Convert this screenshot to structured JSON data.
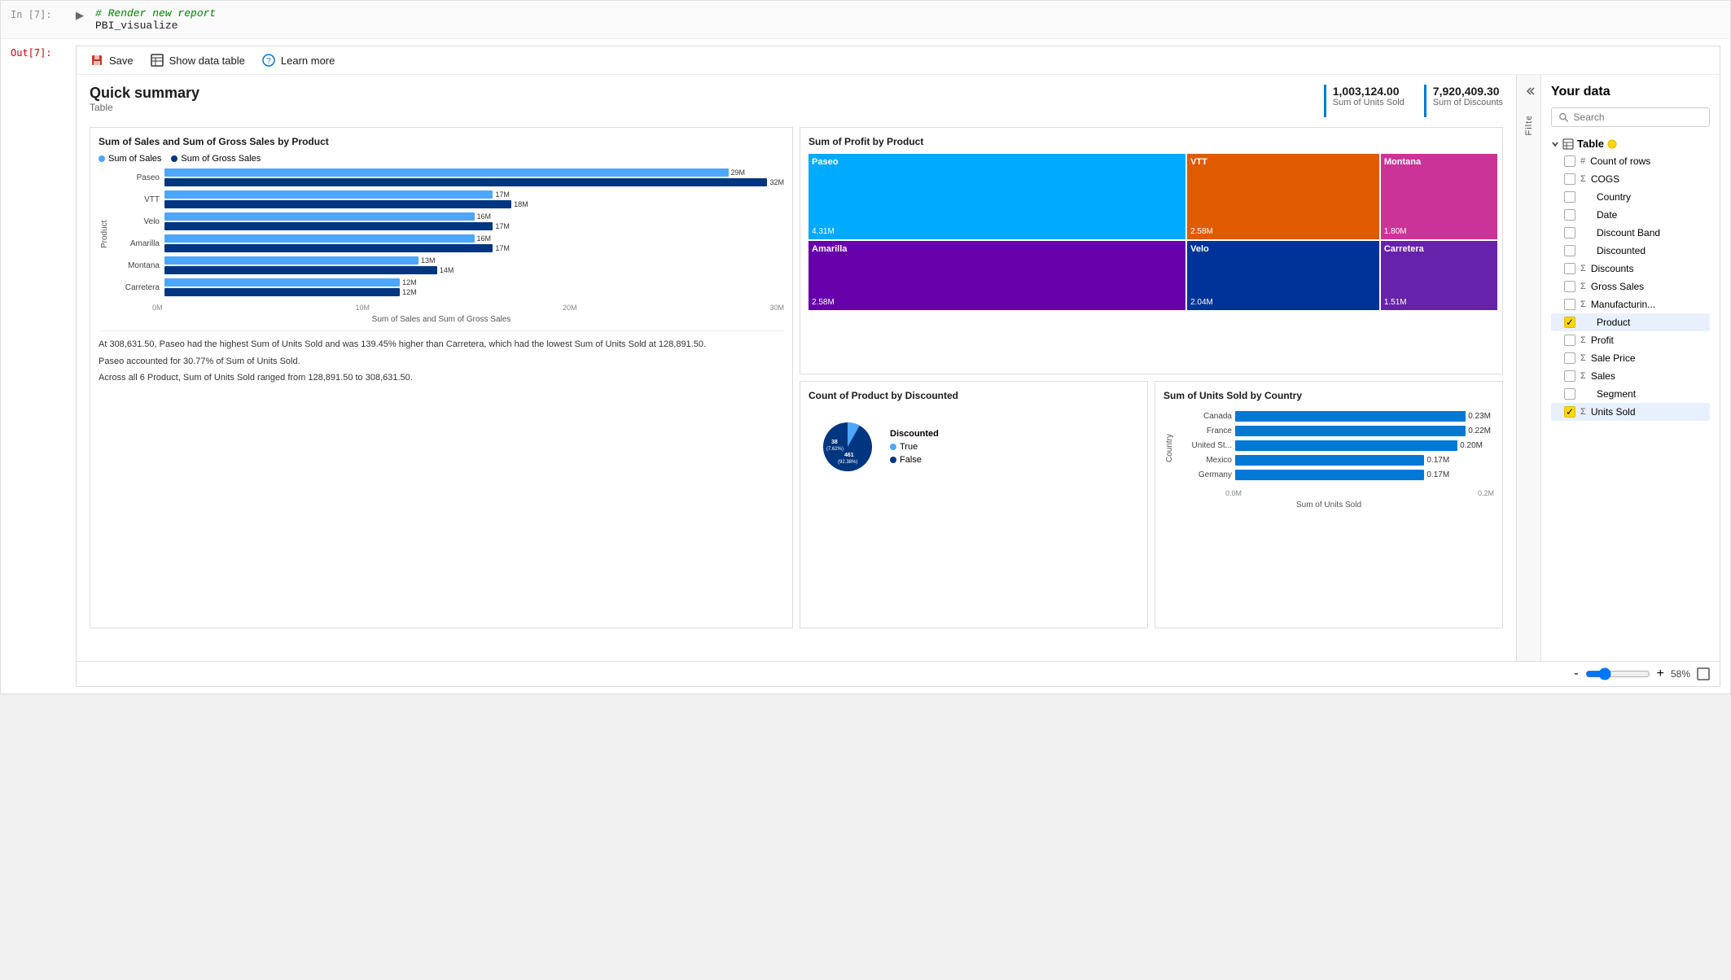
{
  "notebook": {
    "in_label": "In [7]:",
    "out_label": "Out[7]:",
    "comment": "# Render new report",
    "code": "PBI_visualize"
  },
  "toolbar": {
    "save_label": "Save",
    "show_data_table_label": "Show data table",
    "learn_more_label": "Learn more"
  },
  "quick_summary": {
    "title": "Quick summary",
    "subtitle": "Table",
    "stat1_value": "1,003,124.00",
    "stat1_label": "Sum of Units Sold",
    "stat2_value": "7,920,409.30",
    "stat2_label": "Sum of Discounts"
  },
  "bar_chart": {
    "title": "Sum of Sales and Sum of Gross Sales by Product",
    "legend": [
      {
        "label": "Sum of Sales",
        "color": "#4da6ff"
      },
      {
        "label": "Sum of Gross Sales",
        "color": "#003580"
      }
    ],
    "y_axis": "Product",
    "x_axis_title": "Sum of Sales and Sum of Gross Sales",
    "axis_labels": [
      "0M",
      "10M",
      "20M",
      "30M"
    ],
    "rows": [
      {
        "product": "Paseo",
        "sales": 29,
        "gross": 32,
        "sales_label": "29M",
        "gross_label": "32M",
        "sales_pct": 91,
        "gross_pct": 100
      },
      {
        "product": "VTT",
        "sales": 17,
        "gross": 18,
        "sales_label": "17M",
        "gross_label": "18M",
        "sales_pct": 53,
        "gross_pct": 56
      },
      {
        "product": "Velo",
        "sales": 16,
        "gross": 17,
        "sales_label": "16M",
        "gross_label": "17M",
        "sales_pct": 50,
        "gross_pct": 53
      },
      {
        "product": "Amarilla",
        "sales": 16,
        "gross": 17,
        "sales_label": "16M",
        "gross_label": "17M",
        "sales_pct": 50,
        "gross_pct": 53
      },
      {
        "product": "Montana",
        "sales": 13,
        "gross": 14,
        "sales_label": "13M",
        "gross_label": "14M",
        "sales_pct": 41,
        "gross_pct": 44
      },
      {
        "product": "Carretera",
        "sales": 12,
        "gross": 12,
        "sales_label": "12M",
        "gross_label": "12M",
        "sales_pct": 38,
        "gross_pct": 38
      }
    ],
    "text_summary": [
      "At 308,631.50, Paseo had the highest Sum of Units Sold and was 139.45% higher than Carretera, which had the lowest Sum of Units Sold at 128,891.50.",
      "Paseo accounted for 30.77% of Sum of Units Sold.",
      "Across all 6 Product, Sum of Units Sold ranged from 128,891.50 to 308,631.50."
    ]
  },
  "treemap": {
    "title": "Sum of Profit by Product",
    "cells": [
      {
        "label": "Paseo",
        "value": "4.31M",
        "color": "#00aaff",
        "col": 1,
        "row": 1
      },
      {
        "label": "VTT",
        "value": "2.58M",
        "color": "#e05a00",
        "col": 2,
        "row": 1
      },
      {
        "label": "Montana",
        "value": "1.80M",
        "color": "#cc3399",
        "col": 3,
        "row": 1
      },
      {
        "label": "Amarilla",
        "value": "2.58M",
        "color": "#6600aa",
        "col": 1,
        "row": 2
      },
      {
        "label": "Velo",
        "value": "2.04M",
        "color": "#003399",
        "col": 2,
        "row": 2
      },
      {
        "label": "Carretera",
        "value": "1.51M",
        "color": "#6622aa",
        "col": 3,
        "row": 2
      }
    ]
  },
  "pie_chart": {
    "title": "Count of Product by Discounted",
    "legend_title": "Discounted",
    "segments": [
      {
        "label": "True",
        "value": "38 (7.62%)",
        "color": "#4da6ff",
        "percent": 7.62
      },
      {
        "label": "False",
        "value": "461 (92.38%)",
        "color": "#003580",
        "percent": 92.38
      }
    ],
    "labels": [
      {
        "text": "38",
        "sub": "(7.62%)"
      },
      {
        "text": "461",
        "sub": "(92.38%)"
      }
    ]
  },
  "hbar_chart": {
    "title": "Sum of Units Sold by Country",
    "y_axis": "Country",
    "x_axis_title": "Sum of Units Sold",
    "axis_labels": [
      "0.0M",
      "0.2M"
    ],
    "rows": [
      {
        "country": "Canada",
        "value": "0.23M",
        "pct": 100
      },
      {
        "country": "France",
        "value": "0.22M",
        "pct": 96
      },
      {
        "country": "United St...",
        "value": "0.20M",
        "pct": 87
      },
      {
        "country": "Mexico",
        "value": "0.17M",
        "pct": 74
      },
      {
        "country": "Germany",
        "value": "0.17M",
        "pct": 74
      }
    ]
  },
  "your_data": {
    "title": "Your data",
    "search_placeholder": "Search",
    "table_name": "Table",
    "fields": [
      {
        "name": "Count of rows",
        "type": "count",
        "checked": false,
        "sigma": false
      },
      {
        "name": "COGS",
        "type": "sigma",
        "checked": false,
        "sigma": true
      },
      {
        "name": "Country",
        "type": "text",
        "checked": false,
        "sigma": false
      },
      {
        "name": "Date",
        "type": "text",
        "checked": false,
        "sigma": false
      },
      {
        "name": "Discount Band",
        "type": "text",
        "checked": false,
        "sigma": false
      },
      {
        "name": "Discounted",
        "type": "text",
        "checked": false,
        "sigma": false
      },
      {
        "name": "Discounts",
        "type": "sigma",
        "checked": false,
        "sigma": true
      },
      {
        "name": "Gross Sales",
        "type": "sigma",
        "checked": false,
        "sigma": true
      },
      {
        "name": "Manufacturin...",
        "type": "sigma",
        "checked": false,
        "sigma": true
      },
      {
        "name": "Product",
        "type": "text",
        "checked": true,
        "sigma": false
      },
      {
        "name": "Profit",
        "type": "sigma",
        "checked": false,
        "sigma": true
      },
      {
        "name": "Sale Price",
        "type": "sigma",
        "checked": false,
        "sigma": true
      },
      {
        "name": "Sales",
        "type": "sigma",
        "checked": false,
        "sigma": true
      },
      {
        "name": "Segment",
        "type": "text",
        "checked": false,
        "sigma": false
      },
      {
        "name": "Units Sold",
        "type": "sigma",
        "checked": true,
        "sigma": true
      }
    ]
  },
  "zoom": {
    "level": "58%",
    "minus": "-",
    "plus": "+"
  }
}
